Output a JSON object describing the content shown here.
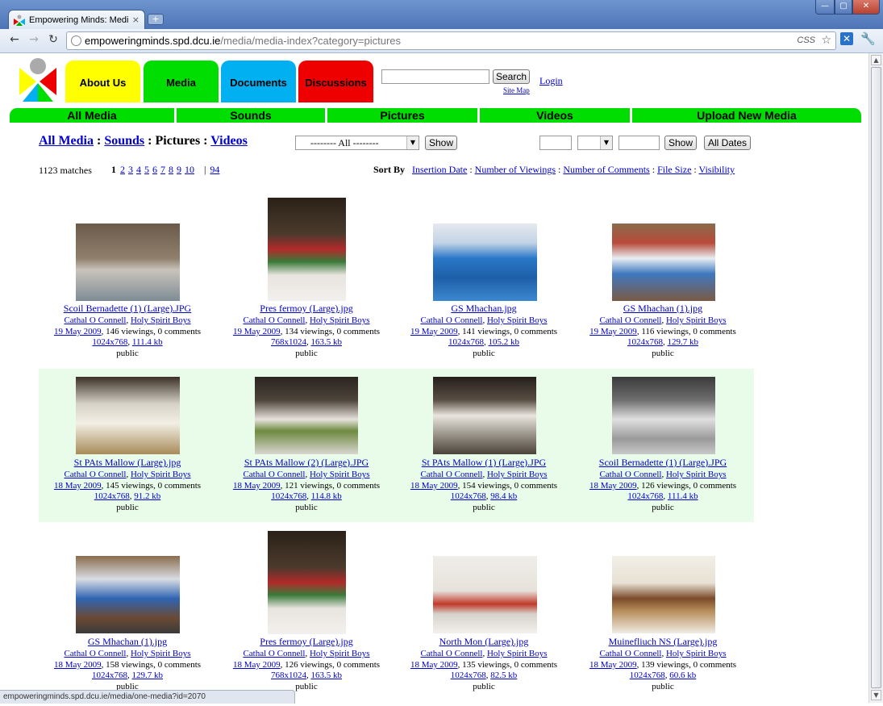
{
  "browser": {
    "tab_title": "Empowering Minds: Media I...",
    "tab_close": "×",
    "new_tab": "+",
    "url_host": "empoweringminds.spd.dcu.ie",
    "url_path": "/media/media-index?category=pictures",
    "css_badge": "CSS",
    "back": "←",
    "forward": "→",
    "reload": "↻",
    "star": "☆",
    "status_url": "empoweringminds.spd.dcu.ie/media/one-media?id=2070"
  },
  "header": {
    "tabs": [
      "About Us",
      "Media",
      "Documents",
      "Discussions"
    ],
    "search_button": "Search",
    "site_map": "Site Map",
    "login": "Login"
  },
  "media_nav": [
    "All Media",
    "Sounds",
    "Pictures",
    "Videos",
    "Upload New Media"
  ],
  "filter": {
    "crumb_all": "All Media",
    "crumb_sounds": "Sounds",
    "crumb_sep": " : ",
    "crumb_pictures": "Pictures",
    "crumb_videos": "Videos",
    "category_select": "--------  All  --------",
    "show_button": "Show",
    "show_button2": "Show",
    "all_dates_button": "All Dates"
  },
  "results": {
    "matches": "1123 matches",
    "current_page": "1",
    "pages": [
      "2",
      "3",
      "4",
      "5",
      "6",
      "7",
      "8",
      "9",
      "10"
    ],
    "pipe": "|",
    "last_page": "94",
    "sort_label": "Sort By",
    "sort_options": [
      "Insertion Date",
      "Number of Viewings",
      "Number of Comments",
      "File Size",
      "Visibility"
    ],
    "sort_sep": " : "
  },
  "items": [
    {
      "title": "Scoil Bernadette (1) (Large).JPG",
      "author": "Cathal O Connell",
      "group": "Holy Spirit Boys",
      "date": "19 May 2009",
      "stats": ", 146 viewings, 0 comments",
      "dims": "1024x768",
      "size": "111.4 kb",
      "visibility": "public"
    },
    {
      "title": "Pres fermoy (Large).jpg",
      "author": "Cathal O Connell",
      "group": "Holy Spirit Boys",
      "date": "19 May 2009",
      "stats": ", 134 viewings, 0 comments",
      "dims": "768x1024",
      "size": "163.5 kb",
      "visibility": "public"
    },
    {
      "title": "GS Mhachan.jpg",
      "author": "Cathal O Connell",
      "group": "Holy Spirit Boys",
      "date": "19 May 2009",
      "stats": ", 141 viewings, 0 comments",
      "dims": "1024x768",
      "size": "105.2 kb",
      "visibility": "public"
    },
    {
      "title": "GS Mhachan (1).jpg",
      "author": "Cathal O Connell",
      "group": "Holy Spirit Boys",
      "date": "19 May 2009",
      "stats": ", 116 viewings, 0 comments",
      "dims": "1024x768",
      "size": "129.7 kb",
      "visibility": "public"
    },
    {
      "title": "St PAts Mallow (Large).jpg",
      "author": "Cathal O Connell",
      "group": "Holy Spirit Boys",
      "date": "18 May 2009",
      "stats": ", 145 viewings, 0 comments",
      "dims": "1024x768",
      "size": "91.2 kb",
      "visibility": "public"
    },
    {
      "title": "St PAts Mallow (2) (Large).JPG",
      "author": "Cathal O Connell",
      "group": "Holy Spirit Boys",
      "date": "18 May 2009",
      "stats": ", 121 viewings, 0 comments",
      "dims": "1024x768",
      "size": "114.8 kb",
      "visibility": "public"
    },
    {
      "title": "St PAts Mallow (1) (Large).JPG",
      "author": "Cathal O Connell",
      "group": "Holy Spirit Boys",
      "date": "18 May 2009",
      "stats": ", 154 viewings, 0 comments",
      "dims": "1024x768",
      "size": "98.4 kb",
      "visibility": "public"
    },
    {
      "title": "Scoil Bernadette (1) (Large).JPG",
      "author": "Cathal O Connell",
      "group": "Holy Spirit Boys",
      "date": "18 May 2009",
      "stats": ", 126 viewings, 0 comments",
      "dims": "1024x768",
      "size": "111.4 kb",
      "visibility": "public"
    },
    {
      "title": "GS Mhachan (1).jpg",
      "author": "Cathal O Connell",
      "group": "Holy Spirit Boys",
      "date": "18 May 2009",
      "stats": ", 158 viewings, 0 comments",
      "dims": "1024x768",
      "size": "129.7 kb",
      "visibility": "public"
    },
    {
      "title": "Pres fermoy (Large).jpg",
      "author": "Cathal O Connell",
      "group": "Holy Spirit Boys",
      "date": "18 May 2009",
      "stats": ", 126 viewings, 0 comments",
      "dims": "768x1024",
      "size": "163.5 kb",
      "visibility": "public"
    },
    {
      "title": "North Mon (Large).jpg",
      "author": "Cathal O Connell",
      "group": "Holy Spirit Boys",
      "date": "18 May 2009",
      "stats": ", 135 viewings, 0 comments",
      "dims": "1024x768",
      "size": "82.5 kb",
      "visibility": "public"
    },
    {
      "title": "Muinefliuch NS (Large).jpg",
      "author": "Cathal O Connell",
      "group": "Holy Spirit Boys",
      "date": "18 May 2009",
      "stats": ", 139 viewings, 0 comments",
      "dims": "1024x768",
      "size": "60.6 kb",
      "visibility": "public"
    }
  ],
  "colors": {
    "link": "#0000cc",
    "nav_green": "#00dd00",
    "tab_yellow": "#ffff00",
    "tab_blue": "#00b0f0",
    "tab_red": "#ee0000",
    "row_highlight": "#e9fbe9"
  }
}
